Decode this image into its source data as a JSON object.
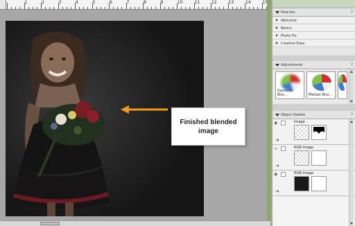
{
  "colors": {
    "accent_arrow": "#f39a1e",
    "frame_green": "#8aa86a",
    "canvas_bg": "#a7a7a7",
    "photo_bg": "#1d1d1d"
  },
  "ruler": {
    "labels": [
      "1",
      "2",
      "3",
      "4",
      "5",
      "6",
      "7",
      "8",
      "9",
      "10",
      "11",
      "12",
      "13",
      "14",
      "15"
    ]
  },
  "callout": {
    "line1": "Finished blended",
    "line2": "image"
  },
  "panels": {
    "howto": {
      "title": "How-tos",
      "items": [
        "Welcome",
        "Basics",
        "Photo Fix",
        "Creative Ease"
      ]
    },
    "adjustments": {
      "title": "Adjustments",
      "thumbs": [
        "Gaussian Blur...",
        "Median Blur..."
      ]
    },
    "objects": {
      "title": "Object Palette",
      "rows": [
        "Image",
        "RGB Image",
        "RGB Image"
      ]
    },
    "controls": "?"
  },
  "icons": [
    "arrow-left-icon",
    "eye-icon",
    "lock-icon",
    "move-arrow-icon",
    "triangle-down-icon",
    "triangle-right-icon"
  ]
}
